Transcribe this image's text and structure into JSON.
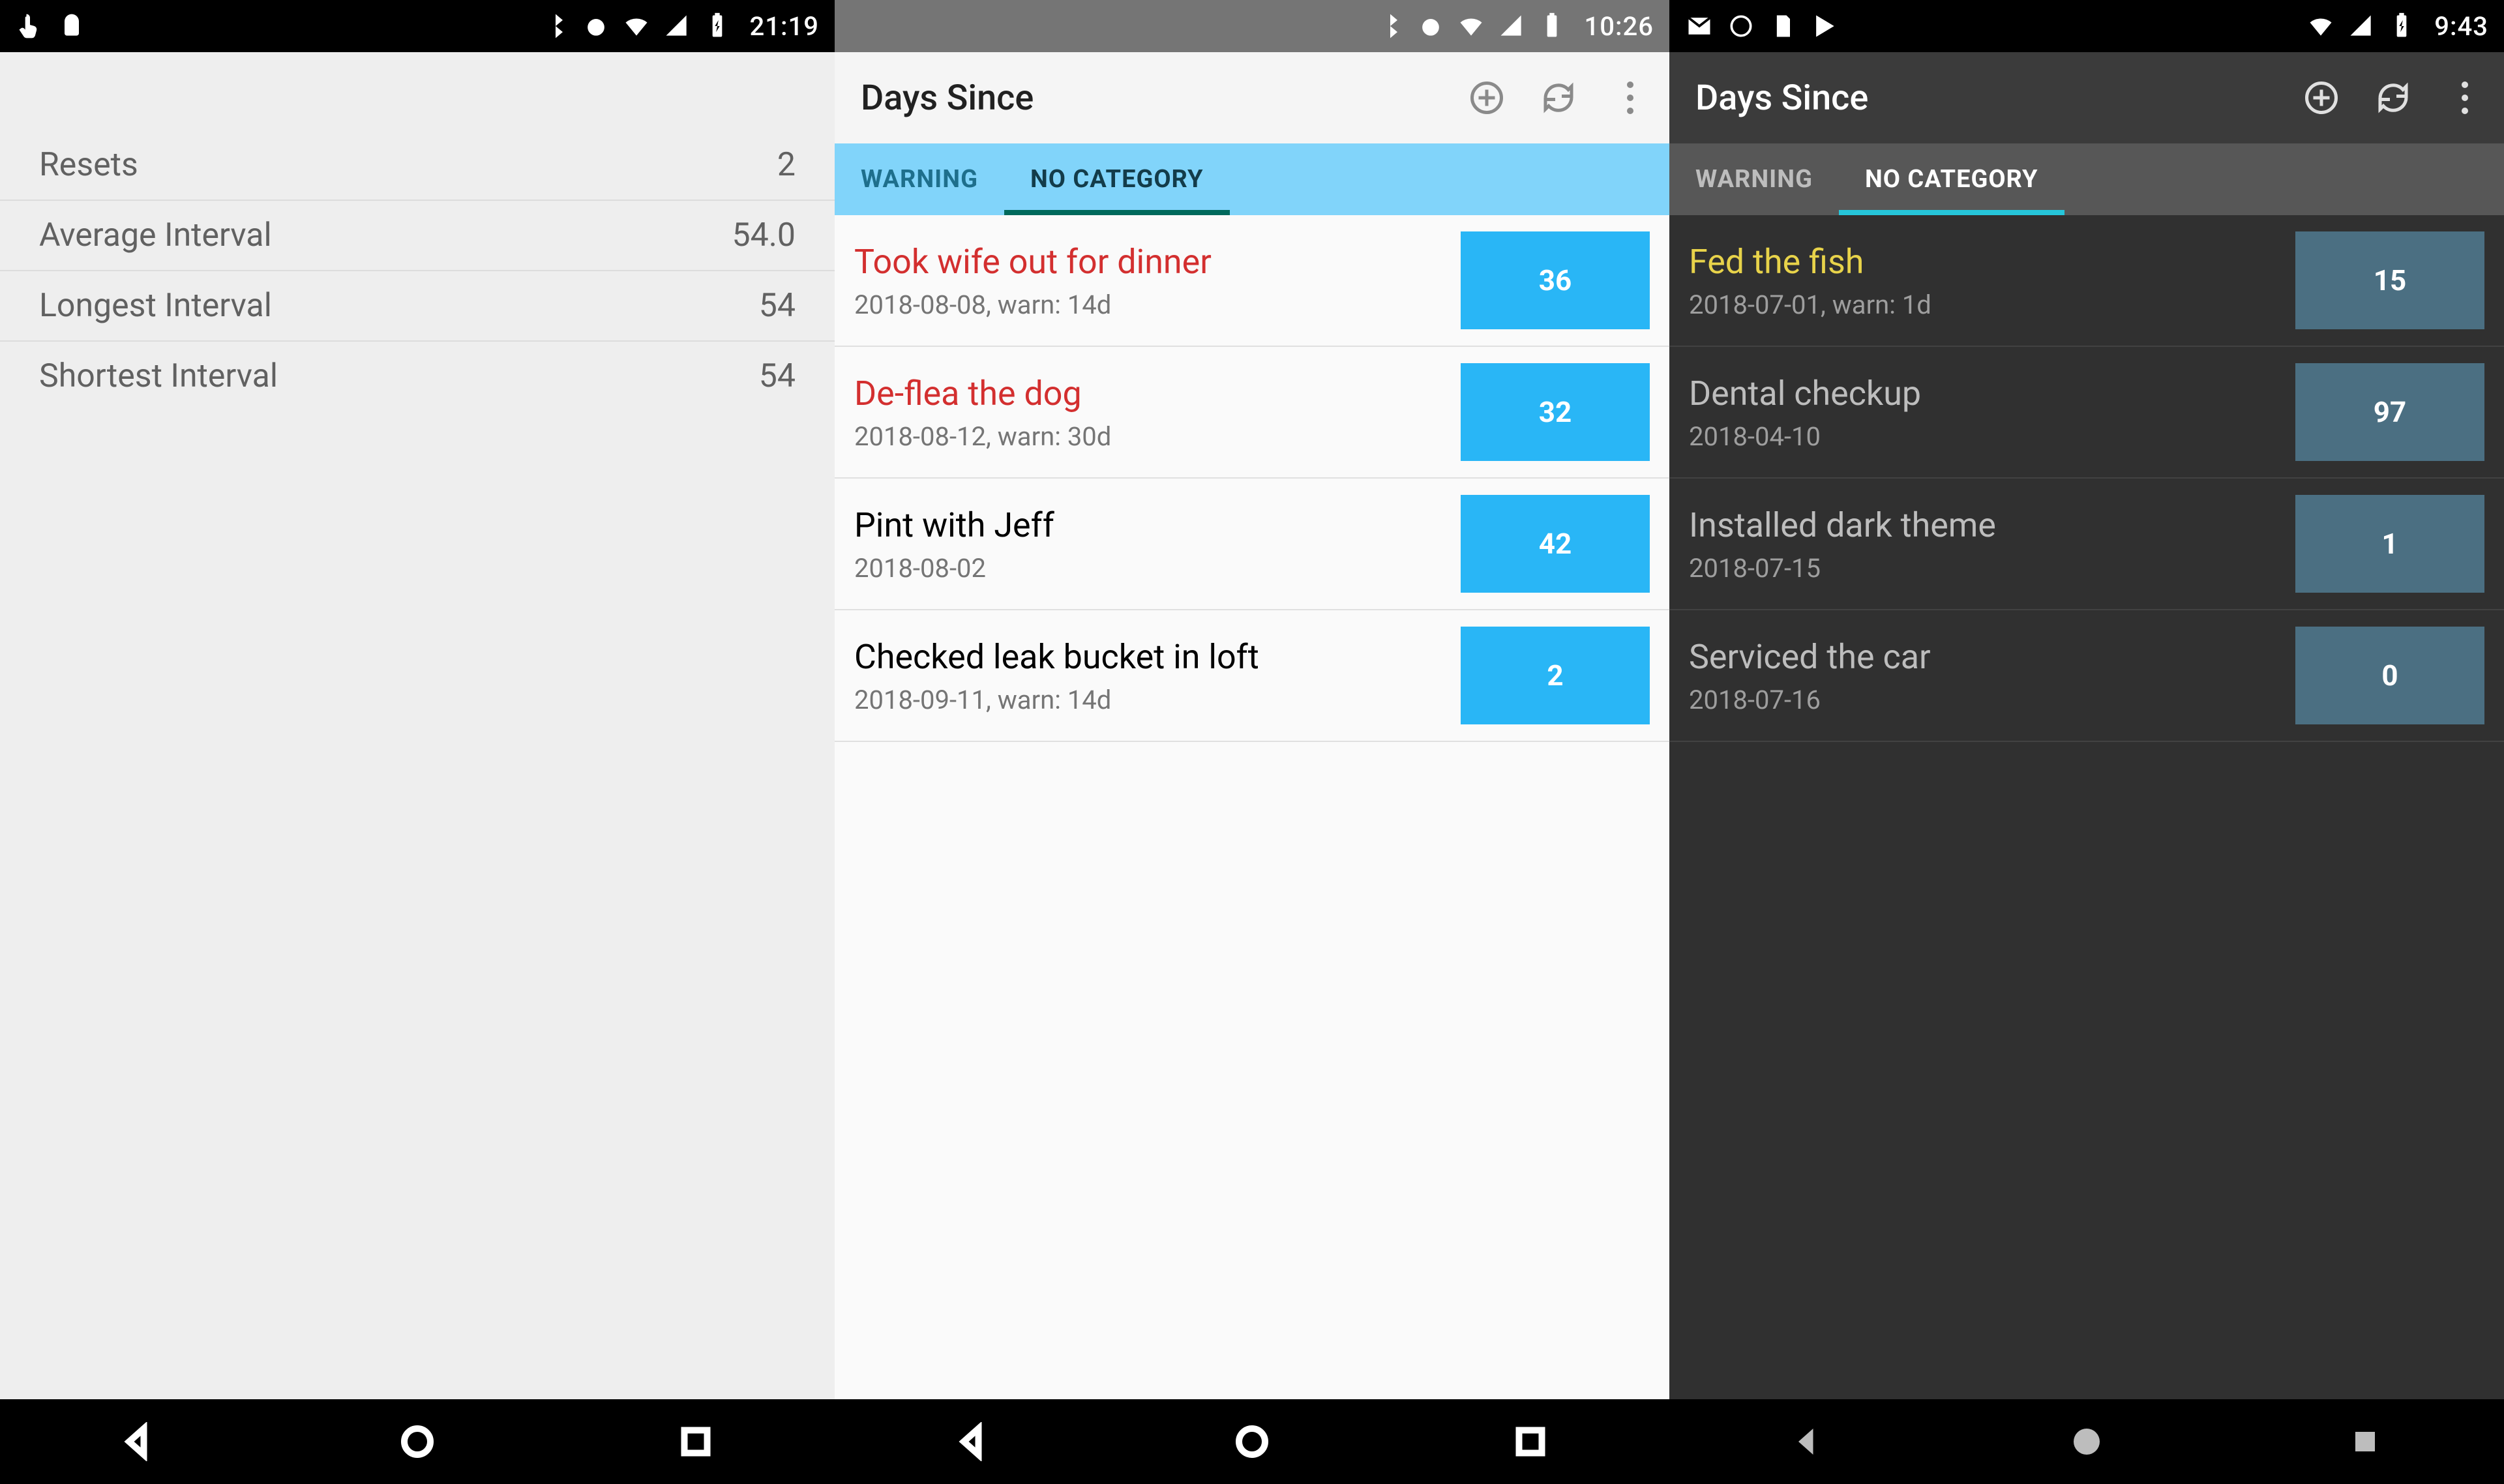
{
  "phone1": {
    "status": {
      "time": "21:19"
    },
    "stats": [
      {
        "label": "Resets",
        "value": "2"
      },
      {
        "label": "Average Interval",
        "value": "54.0"
      },
      {
        "label": "Longest Interval",
        "value": "54"
      },
      {
        "label": "Shortest Interval",
        "value": "54"
      }
    ]
  },
  "phone2": {
    "status": {
      "time": "10:26"
    },
    "app_title": "Days Since",
    "tabs": {
      "warning": "WARNING",
      "nocat": "NO CATEGORY"
    },
    "rows": [
      {
        "title": "Took wife out for dinner",
        "sub": "2018-08-08, warn: 14d",
        "days": "36",
        "red": true
      },
      {
        "title": "De-flea the dog",
        "sub": "2018-08-12, warn: 30d",
        "days": "32",
        "red": true
      },
      {
        "title": "Pint with Jeff",
        "sub": "2018-08-02",
        "days": "42",
        "red": false
      },
      {
        "title": "Checked leak bucket in loft",
        "sub": "2018-09-11, warn: 14d",
        "days": "2",
        "red": false
      }
    ]
  },
  "phone3": {
    "status": {
      "time": "9:43"
    },
    "app_title": "Days Since",
    "tabs": {
      "warning": "WARNING",
      "nocat": "NO CATEGORY"
    },
    "rows": [
      {
        "title": "Fed the fish",
        "sub": "2018-07-01, warn: 1d",
        "days": "15",
        "yellow": true
      },
      {
        "title": "Dental checkup",
        "sub": "2018-04-10",
        "days": "97"
      },
      {
        "title": "Installed dark theme",
        "sub": "2018-07-15",
        "days": "1"
      },
      {
        "title": "Serviced the car",
        "sub": "2018-07-16",
        "days": "0"
      }
    ]
  }
}
